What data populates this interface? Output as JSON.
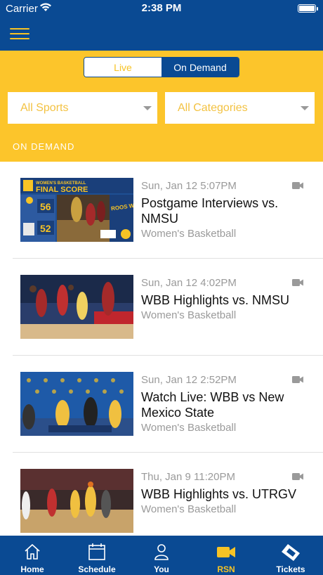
{
  "status": {
    "carrier": "Carrier",
    "time": "2:38 PM"
  },
  "segment": {
    "live_label": "Live",
    "on_demand_label": "On Demand"
  },
  "filters": {
    "sports_label": "All Sports",
    "categories_label": "All Categories"
  },
  "section_label": "ON DEMAND",
  "items": [
    {
      "date": "Sun, Jan 12 5:07PM",
      "title": "Postgame Interviews vs. NMSU",
      "sport": "Women's Basketball"
    },
    {
      "date": "Sun, Jan 12 4:02PM",
      "title": "WBB Highlights vs. NMSU",
      "sport": "Women's Basketball"
    },
    {
      "date": "Sun, Jan 12 2:52PM",
      "title": "Watch Live: WBB vs New Mexico State",
      "sport": "Women's Basketball"
    },
    {
      "date": "Thu, Jan 9 11:20PM",
      "title": "WBB Highlights vs. UTRGV",
      "sport": "Women's Basketball"
    }
  ],
  "thumb1": {
    "banner": "WOMEN'S BASKETBALL",
    "heading": "FINAL SCORE",
    "score_top": "56",
    "score_bottom": "52",
    "win_text": "ROOS WIN!"
  },
  "tabs": [
    {
      "label": "Home",
      "icon": "home-icon"
    },
    {
      "label": "Schedule",
      "icon": "calendar-icon"
    },
    {
      "label": "You",
      "icon": "person-icon"
    },
    {
      "label": "RSN",
      "icon": "video-camera-icon"
    },
    {
      "label": "Tickets",
      "icon": "ticket-icon"
    }
  ],
  "colors": {
    "navy": "#0a4a93",
    "gold": "#fcc52b",
    "gold_text": "#f7c325"
  }
}
